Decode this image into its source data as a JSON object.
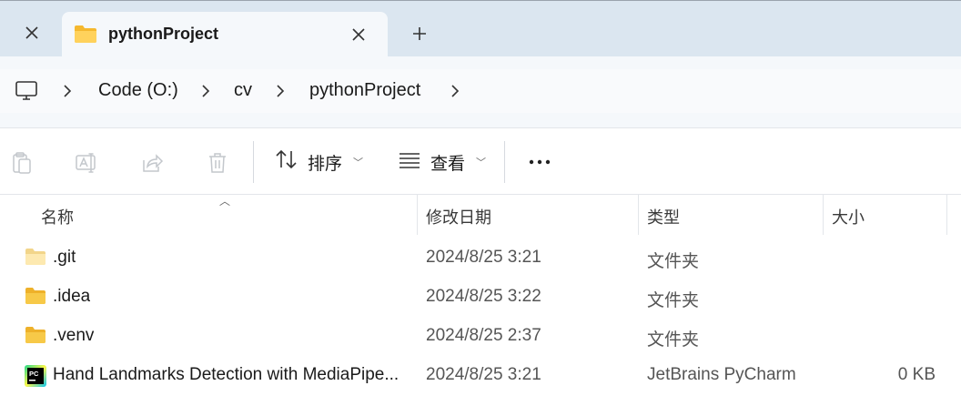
{
  "tab": {
    "title": "pythonProject"
  },
  "address": {
    "crumbs": [
      "Code (O:)",
      "cv",
      "pythonProject"
    ]
  },
  "toolbar": {
    "sort_label": "排序",
    "view_label": "查看"
  },
  "columns": {
    "name": "名称",
    "date": "修改日期",
    "type": "类型",
    "size": "大小"
  },
  "files": [
    {
      "name": ".git",
      "date": "2024/8/25 3:21",
      "type": "文件夹",
      "size": "",
      "icon": "folder-icon"
    },
    {
      "name": ".idea",
      "date": "2024/8/25 3:22",
      "type": "文件夹",
      "size": "",
      "icon": "folder-icon"
    },
    {
      "name": ".venv",
      "date": "2024/8/25 2:37",
      "type": "文件夹",
      "size": "",
      "icon": "folder-icon"
    },
    {
      "name": "Hand Landmarks Detection with MediaPipe...",
      "date": "2024/8/25 3:21",
      "type": "JetBrains PyCharm",
      "size": "0 KB",
      "icon": "pycharm-file-icon"
    }
  ],
  "colors": {
    "tabstrip_bg": "#dbe6f0",
    "folder_yellow": "#f7c948"
  }
}
